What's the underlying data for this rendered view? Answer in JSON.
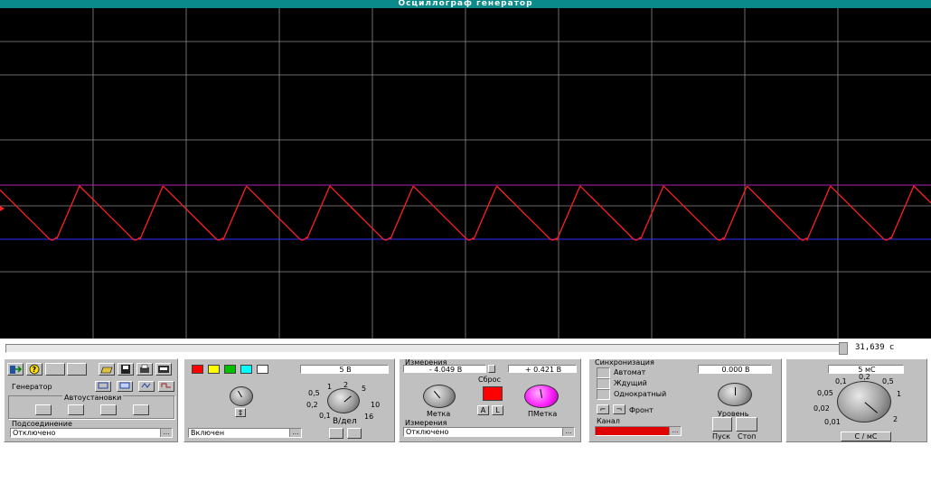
{
  "window": {
    "title": "Осциллограф  генератор"
  },
  "colors": {
    "trace": "#ff2020",
    "marker1": "#b020b0",
    "marker2": "#3030ff",
    "grid": "#8a8a8a",
    "screen": "#000000"
  },
  "scroll": {
    "time_readout": "31,639  c"
  },
  "generator": {
    "label": "Генератор",
    "autotest_label": "Автоустановки",
    "connection_label": "Подсоединение",
    "connection_value": "Отключено",
    "toolbar_icons": [
      "exit-icon",
      "help-icon",
      "blank",
      "blank",
      "open-icon",
      "save-icon",
      "print-icon",
      "settings-icon"
    ]
  },
  "channel": {
    "volts_readout": "5   В",
    "swatch_colors": [
      "#ff0000",
      "#ffff00",
      "#00c000",
      "#00ffff",
      "#ffffff"
    ],
    "scale_label": "В/дел",
    "scale_ticks": [
      "0,1",
      "0,2",
      "0,5",
      "1",
      "2",
      "5",
      "10",
      "16"
    ],
    "state_value": "Включен"
  },
  "measure": {
    "title": "Измерения",
    "marker1_value": "-  4,049  В",
    "marker2_value": "+  0,421  В",
    "reset_label": "Сброс",
    "marker1_label": "Метка",
    "marker2_label": "ПМетка",
    "source_label": "Измерения",
    "source_value": "Отключено"
  },
  "sync": {
    "title": "Синхронизация",
    "options": [
      "Автомат",
      "Ждущий",
      "Однократный"
    ],
    "level_readout": "0.000  В",
    "level_label": "Уровень",
    "front_label": "Фронт",
    "channel_label": "Канал",
    "start_label": "Пуск",
    "stop_label": "Стоп"
  },
  "timebase": {
    "readout": "5  мС",
    "ticks": [
      "0,01",
      "0,02",
      "0,05",
      "0,1",
      "0,2",
      "0,5",
      "1",
      "2"
    ],
    "unit_button": "С / мС"
  }
}
